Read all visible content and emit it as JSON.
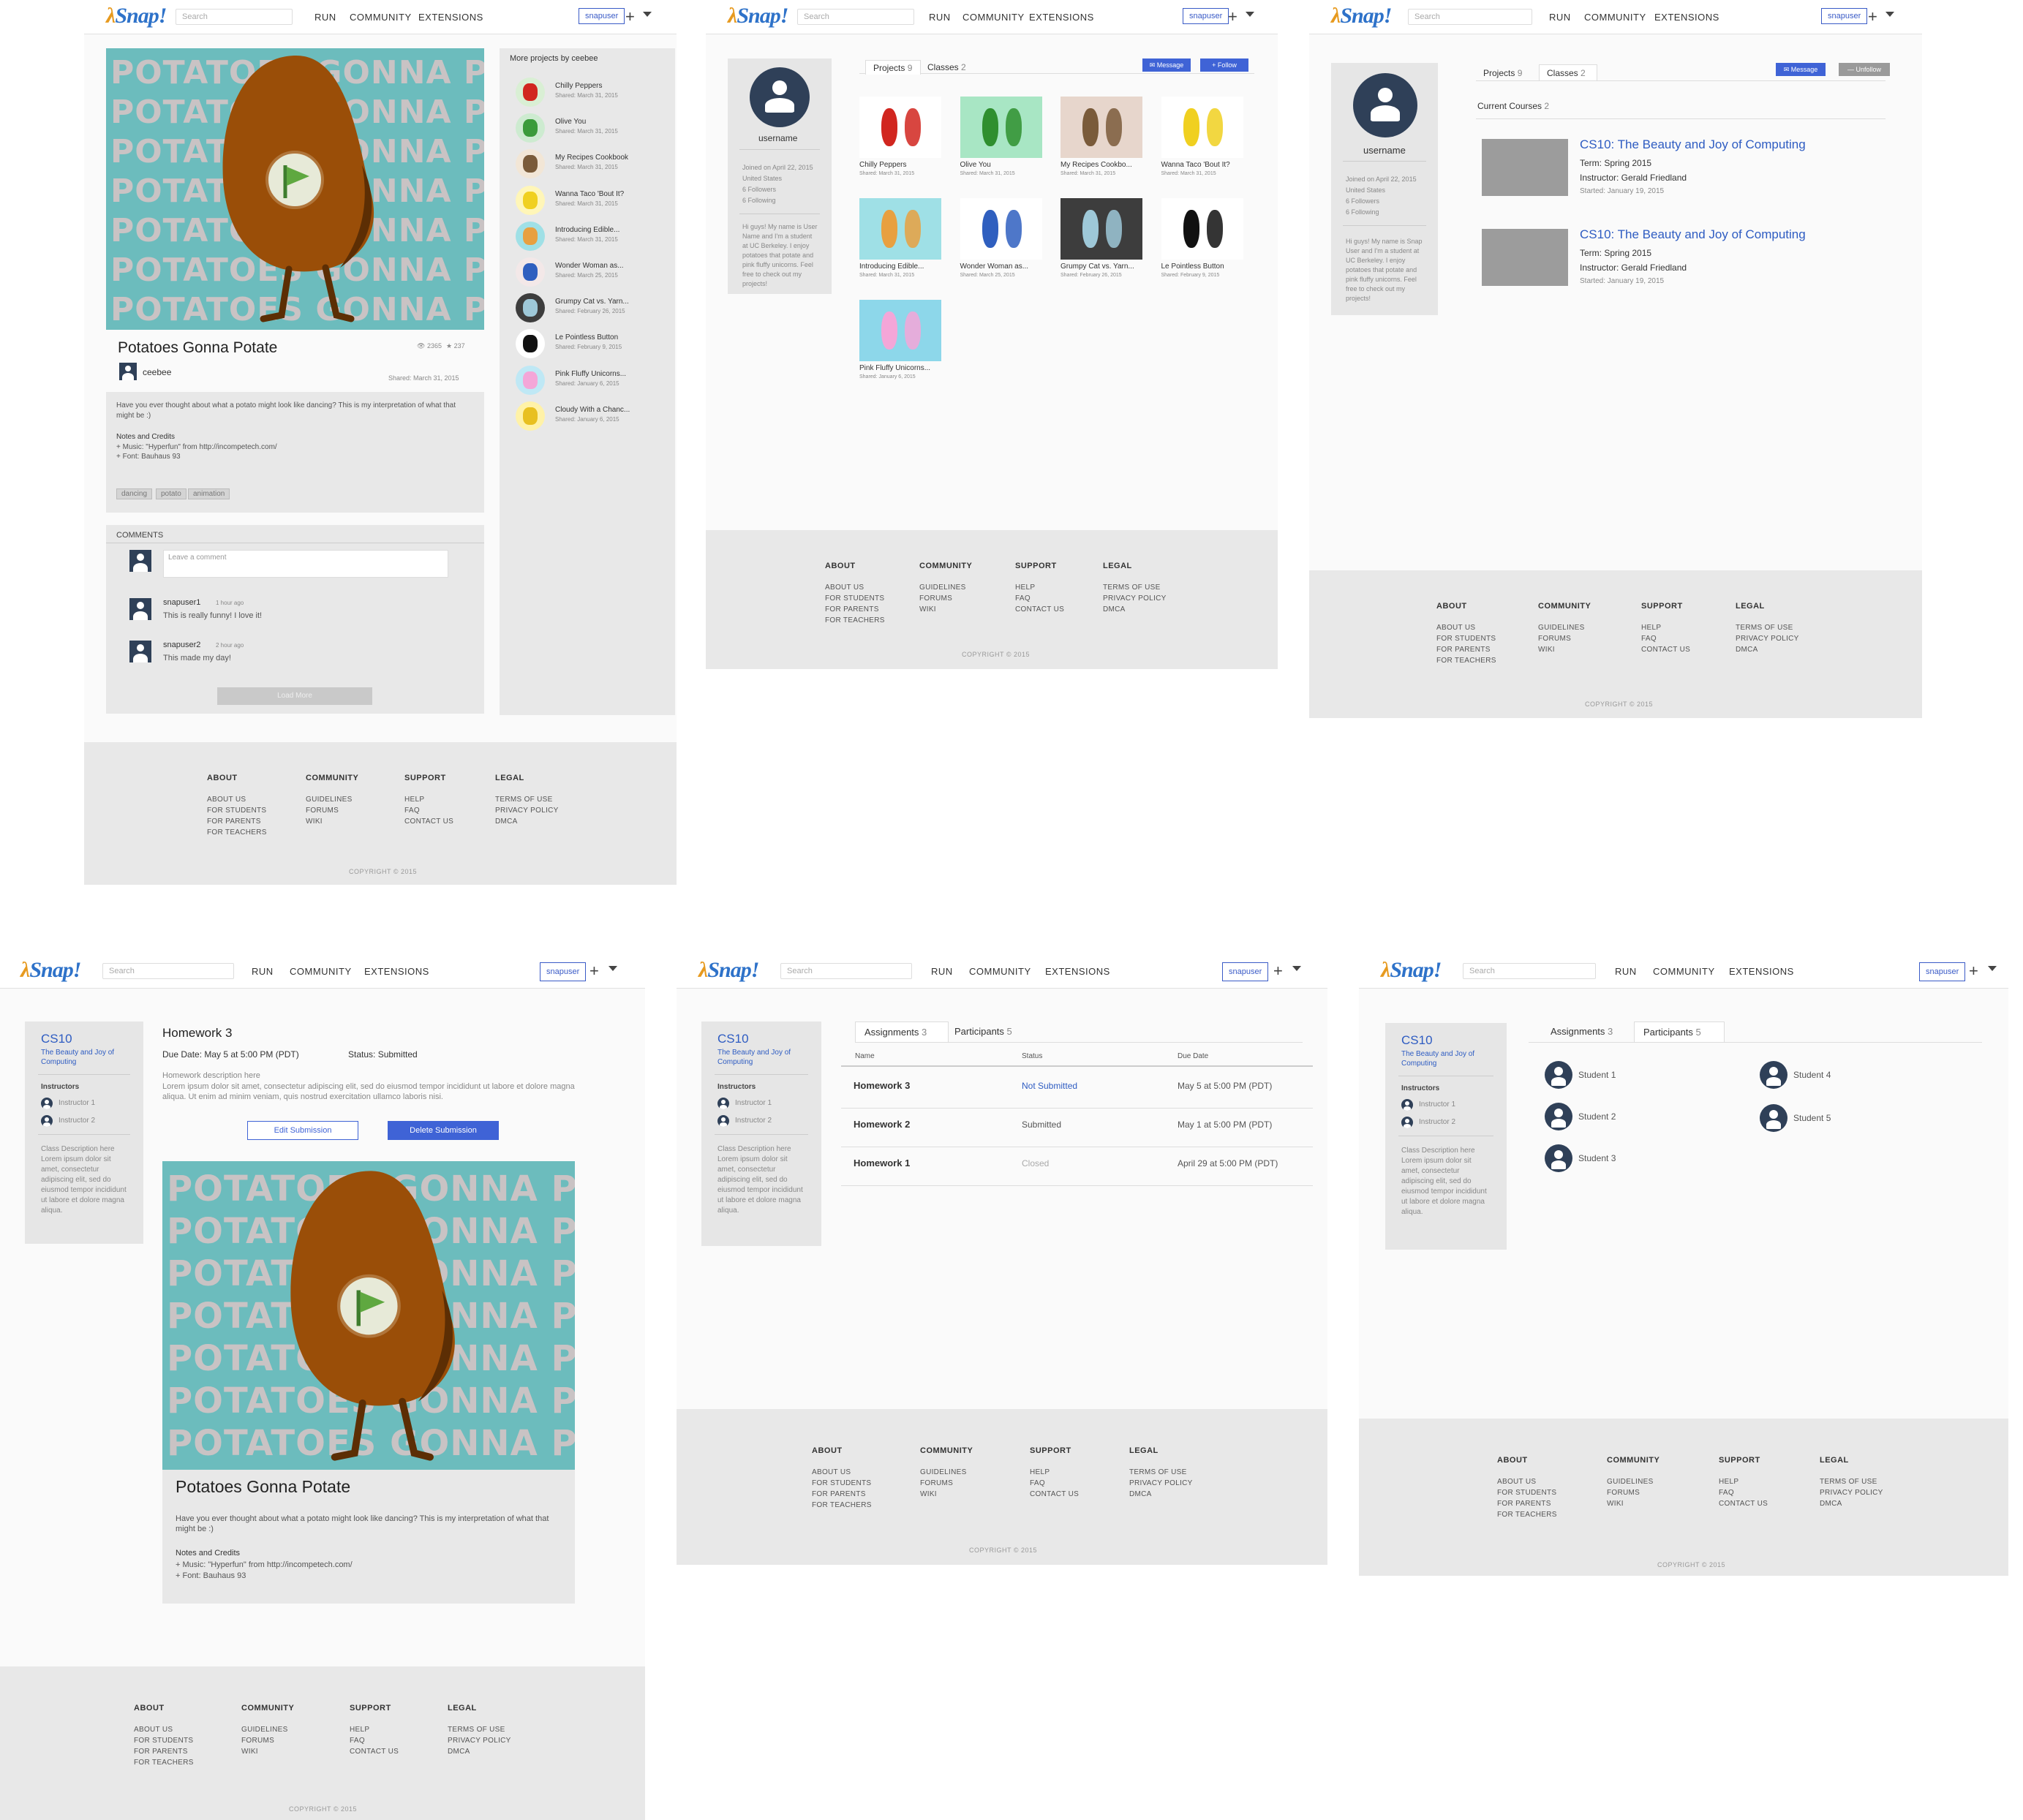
{
  "nav": {
    "logo": "Snap!",
    "search_placeholder": "Search",
    "links": [
      "RUN",
      "COMMUNITY",
      "EXTENSIONS"
    ],
    "user": "snapuser",
    "plus": "+"
  },
  "footer": {
    "about": {
      "title": "ABOUT",
      "items": [
        "ABOUT US",
        "FOR STUDENTS",
        "FOR PARENTS",
        "FOR TEACHERS"
      ]
    },
    "community": {
      "title": "COMMUNITY",
      "items": [
        "GUIDELINES",
        "FORUMS",
        "WIKI"
      ]
    },
    "support": {
      "title": "SUPPORT",
      "items": [
        "HELP",
        "FAQ",
        "CONTACT US"
      ]
    },
    "legal": {
      "title": "LEGAL",
      "items": [
        "TERMS OF USE",
        "PRIVACY POLICY",
        "DMCA"
      ]
    },
    "copyright": "COPYRIGHT © 2015"
  },
  "project": {
    "title": "Potatoes Gonna Potate",
    "views": "2365",
    "stars": "237",
    "author": "ceebee",
    "shared": "Shared: March 31, 2015",
    "description": "Have you ever thought about what a potato might look like dancing? This is my interpretation of what that might be :)",
    "notes_title": "Notes and Credits",
    "notes": [
      "+ Music: \"Hyperfun\" from http://incompetech.com/",
      "+ Font: Bauhaus 93"
    ],
    "tags": [
      "dancing",
      "potato",
      "animation"
    ],
    "banner_rows": [
      "POTATOES GONNA POTATE",
      "POTATOES GONNA POTATE",
      "POTATOES GONNA POTATE",
      "POTATOES GONNA POTATE",
      "POTATOES GONNA POTATE",
      "POTATOES GONNA POTATE",
      "POTATOES GONNA POTATE"
    ],
    "comments_title": "COMMENTS",
    "comment_placeholder": "Leave a comment",
    "comments": [
      {
        "user": "snapuser1",
        "time": "1 hour ago",
        "text": "This is really funny! I love it!"
      },
      {
        "user": "snapuser2",
        "time": "2 hour ago",
        "text": "This made my day!"
      }
    ],
    "load_more": "Load More",
    "more_title": "More projects by ceebee",
    "more": [
      {
        "title": "Chilly Peppers",
        "date": "Shared: March 31, 2015"
      },
      {
        "title": "Olive You",
        "date": "Shared: March 31, 2015"
      },
      {
        "title": "My Recipes Cookbook",
        "date": "Shared: March 31, 2015"
      },
      {
        "title": "Wanna Taco 'Bout It?",
        "date": "Shared: March 31, 2015"
      },
      {
        "title": "Introducing Edible...",
        "date": "Shared: March 31, 2015"
      },
      {
        "title": "Wonder Woman as...",
        "date": "Shared: March 25, 2015"
      },
      {
        "title": "Grumpy Cat vs. Yarn...",
        "date": "Shared: February 26, 2015"
      },
      {
        "title": "Le Pointless Button",
        "date": "Shared: February 9, 2015"
      },
      {
        "title": "Pink Fluffy Unicorns...",
        "date": "Shared: January 6, 2015"
      },
      {
        "title": "Cloudy With a Chanc...",
        "date": "Shared: January 6, 2015"
      }
    ]
  },
  "profile": {
    "username": "username",
    "meta": [
      "Joined on April 22, 2015",
      "United States",
      "6 Followers",
      "6 Following"
    ],
    "bio": "Hi guys! My name is User Name and I'm a student at UC Berkeley. I enjoy potatoes that potate and pink fluffy unicorns. Feel free to check out my projects!",
    "bio2": "Hi guys! My name is Snap User and I'm a student at UC Berkeley. I enjoy potatoes that potate and pink fluffy unicorns. Feel free to check out my projects!",
    "tab_projects": "Projects",
    "projects_count": "9",
    "tab_classes": "Classes",
    "classes_count": "2",
    "message": "Message",
    "follow": "+ Follow",
    "unfollow": "— Unfollow",
    "projects": [
      {
        "title": "Chilly Peppers",
        "date": "Shared: March 31, 2015"
      },
      {
        "title": "Olive You",
        "date": "Shared: March 31, 2015"
      },
      {
        "title": "My Recipes Cookbo...",
        "date": "Shared: March 31, 2015"
      },
      {
        "title": "Wanna Taco 'Bout It?",
        "date": "Shared: March 31, 2015"
      },
      {
        "title": "Introducing Edible...",
        "date": "Shared: March 31, 2015"
      },
      {
        "title": "Wonder Woman as...",
        "date": "Shared: March 25, 2015"
      },
      {
        "title": "Grumpy Cat vs. Yarn...",
        "date": "Shared: February 26, 2015"
      },
      {
        "title": "Le Pointless Button",
        "date": "Shared: February 9, 2015"
      },
      {
        "title": "Pink Fluffy Unicorns...",
        "date": "Shared: January 6, 2015"
      }
    ],
    "current_courses": "Current Courses",
    "courses_count": "2",
    "courses": [
      {
        "title": "CS10: The Beauty and Joy of Computing",
        "term": "Term: Spring 2015",
        "instructor": "Instructor: Gerald Friedland",
        "started": "Started: January 19, 2015"
      },
      {
        "title": "CS10: The Beauty and Joy of Computing",
        "term": "Term: Spring 2015",
        "instructor": "Instructor: Gerald Friedland",
        "started": "Started: January 19, 2015"
      }
    ]
  },
  "course": {
    "code": "CS10",
    "name": "The Beauty and Joy of Computing",
    "instructors_title": "Instructors",
    "instructors": [
      "Instructor 1",
      "Instructor 2"
    ],
    "description": "Class Description here Lorem ipsum dolor sit amet, consectetur adipiscing elit, sed do eiusmod tempor incididunt ut labore et dolore magna aliqua.",
    "homework_title": "Homework 3",
    "due": "Due Date: May 5 at 5:00 PM (PDT)",
    "status": "Status: Submitted",
    "hw_desc_title": "Homework description here",
    "hw_desc": "Lorem ipsum dolor sit amet, consectetur adipiscing elit, sed do eiusmod tempor incididunt ut labore et dolore magna aliqua. Ut enim ad minim veniam, quis nostrud exercitation ullamco laboris nisi.",
    "edit": "Edit Submission",
    "delete": "Delete Submission",
    "tab_assignments": "Assignments",
    "assignments_count": "3",
    "tab_participants": "Participants",
    "participants_count": "5",
    "columns": [
      "Name",
      "Status",
      "Due Date"
    ],
    "assignments": [
      {
        "name": "Homework 3",
        "status": "Not Submitted",
        "due": "May 5 at 5:00 PM (PDT)"
      },
      {
        "name": "Homework 2",
        "status": "Submitted",
        "due": "May 1 at 5:00 PM (PDT)"
      },
      {
        "name": "Homework 1",
        "status": "Closed",
        "due": "April 29 at 5:00 PM (PDT)"
      }
    ],
    "students": [
      "Student 1",
      "Student 2",
      "Student 3",
      "Student 4",
      "Student 5"
    ]
  },
  "colors": {
    "accent": "#3f63d6",
    "link": "#2e5cc2",
    "teal": "#6cbcbd",
    "potato": "#9a4e08",
    "footer": "#e8e8e8"
  }
}
